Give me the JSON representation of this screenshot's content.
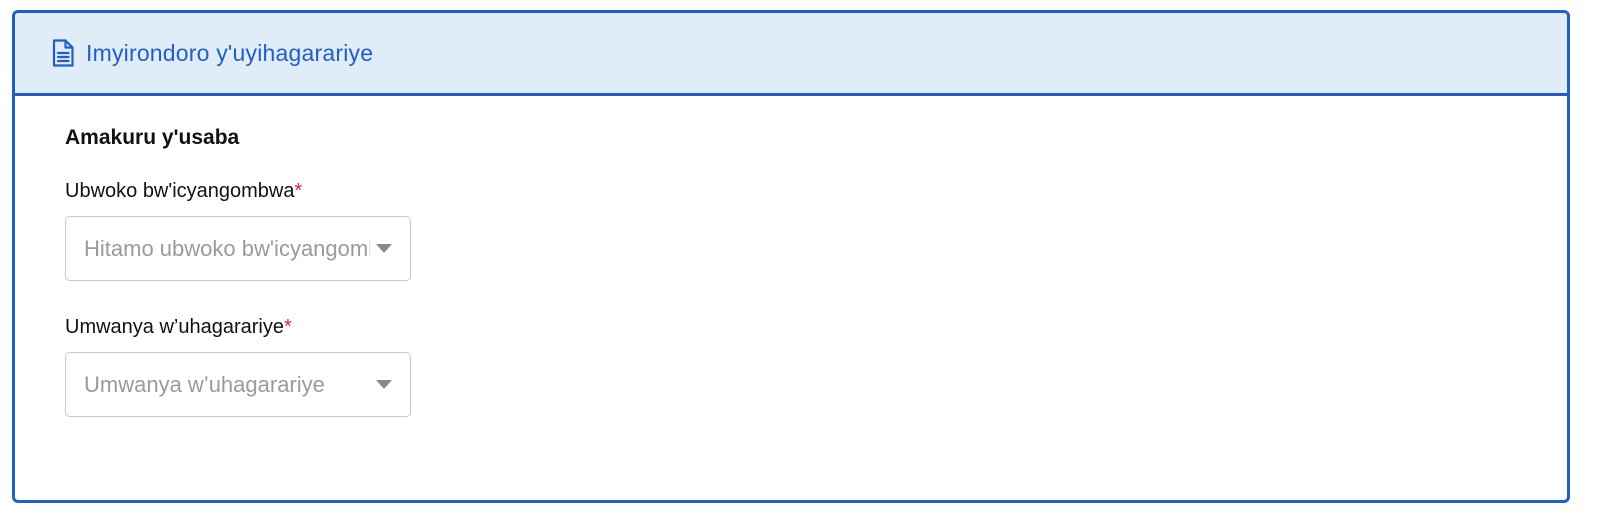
{
  "header": {
    "icon": "document-icon",
    "title": "Imyirondoro y'uyihagarariye"
  },
  "section": {
    "title": "Amakuru y'usaba"
  },
  "fields": [
    {
      "label": "Ubwoko bw'icyangombwa",
      "required_mark": "*",
      "placeholder": "Hitamo ubwoko bw'icyangombwa"
    },
    {
      "label": "Umwanya w’uhagarariye",
      "required_mark": "*",
      "placeholder": "Umwanya w’uhagarariye"
    }
  ],
  "colors": {
    "accent": "#1f5fc6",
    "header_bg": "#e0ecf8",
    "required": "#e0243c",
    "placeholder": "#9a9a9a"
  }
}
